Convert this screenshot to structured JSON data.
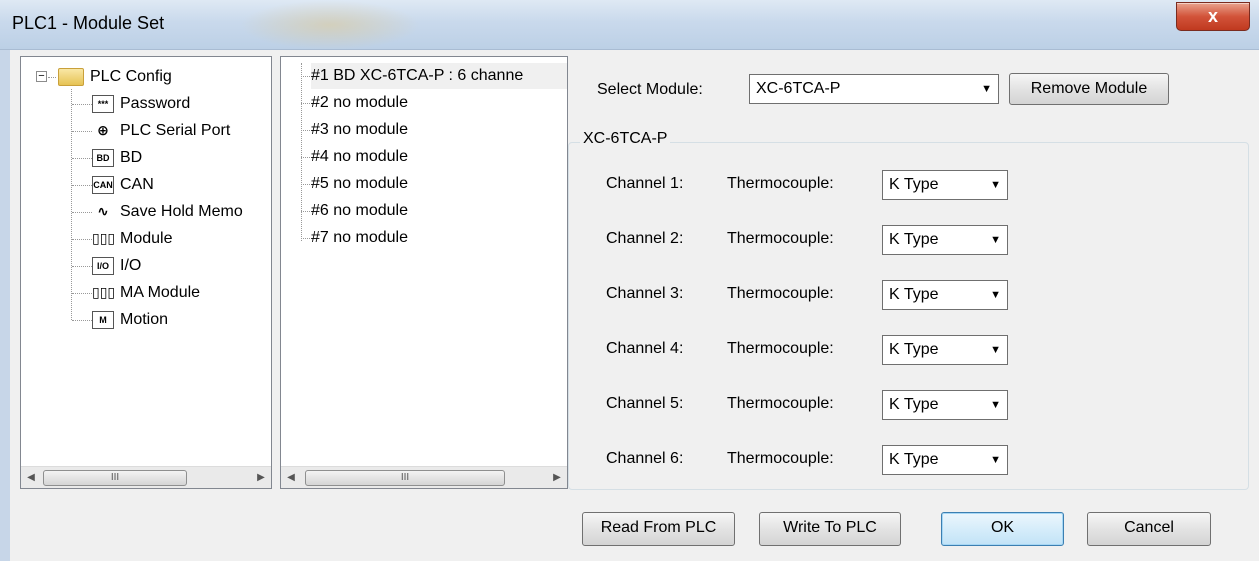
{
  "window": {
    "title": "PLC1 - Module Set",
    "close_label": "x"
  },
  "tree": {
    "root": {
      "label": "PLC Config",
      "expander": "−"
    },
    "items": [
      {
        "label": "Password",
        "icon": "password-icon",
        "glyph": "***"
      },
      {
        "label": "PLC Serial Port",
        "icon": "serial-port-icon",
        "glyph": "⊕"
      },
      {
        "label": "BD",
        "icon": "bd-icon",
        "glyph": "BD"
      },
      {
        "label": "CAN",
        "icon": "can-icon",
        "glyph": "CAN"
      },
      {
        "label": "Save Hold Memo",
        "icon": "save-hold-memory-icon",
        "glyph": "∿"
      },
      {
        "label": "Module",
        "icon": "module-icon",
        "glyph": "▯▯▯"
      },
      {
        "label": "I/O",
        "icon": "io-icon",
        "glyph": "I/O"
      },
      {
        "label": "MA Module",
        "icon": "ma-module-icon",
        "glyph": "▯▯▯"
      },
      {
        "label": "Motion",
        "icon": "motion-icon",
        "glyph": "M"
      }
    ],
    "scroll_thumb": "III"
  },
  "slots": {
    "items": [
      {
        "label": "#1 BD XC-6TCA-P : 6 channe"
      },
      {
        "label": "#2 no module"
      },
      {
        "label": "#3 no module"
      },
      {
        "label": "#4 no module"
      },
      {
        "label": "#5 no module"
      },
      {
        "label": "#6 no module"
      },
      {
        "label": "#7 no module"
      }
    ],
    "scroll_thumb": "III"
  },
  "module": {
    "select_label": "Select Module:",
    "selected": "XC-6TCA-P",
    "remove_label": "Remove Module",
    "group_title": "XC-6TCA-P"
  },
  "channels": [
    {
      "label": "Channel 1:",
      "sensor_label": "Thermocouple:",
      "type": "K Type"
    },
    {
      "label": "Channel 2:",
      "sensor_label": "Thermocouple:",
      "type": "K Type"
    },
    {
      "label": "Channel 3:",
      "sensor_label": "Thermocouple:",
      "type": "K Type"
    },
    {
      "label": "Channel 4:",
      "sensor_label": "Thermocouple:",
      "type": "K Type"
    },
    {
      "label": "Channel 5:",
      "sensor_label": "Thermocouple:",
      "type": "K Type"
    },
    {
      "label": "Channel 6:",
      "sensor_label": "Thermocouple:",
      "type": "K Type"
    }
  ],
  "buttons": {
    "read": "Read From PLC",
    "write": "Write To PLC",
    "ok": "OK",
    "cancel": "Cancel"
  },
  "colors": {
    "close_button": "#c0391f",
    "window_bg": "#f0f0f0",
    "default_button_border": "#3c7fb1"
  }
}
